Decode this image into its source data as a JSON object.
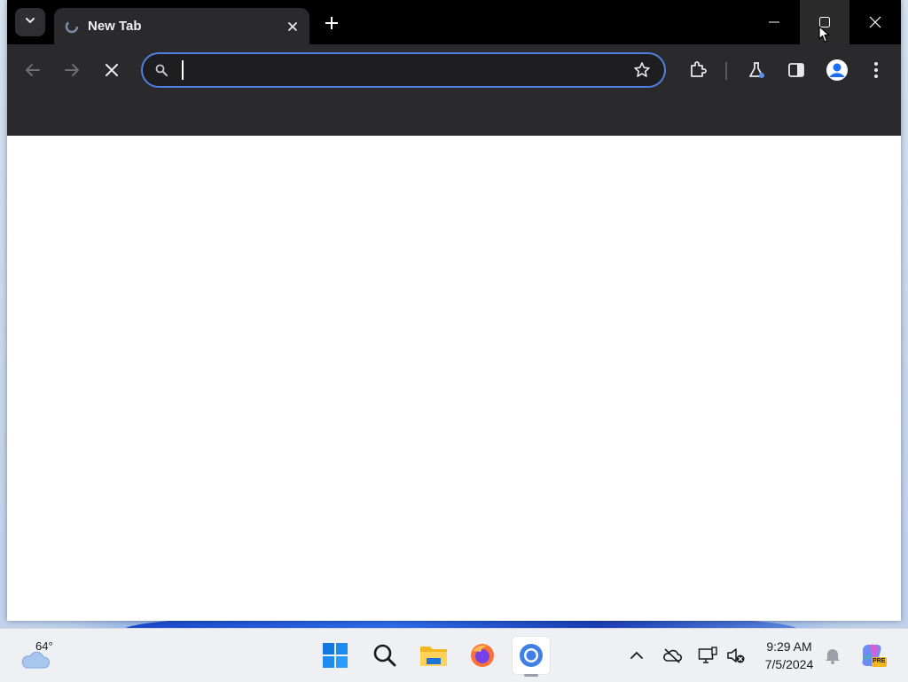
{
  "browser": {
    "tab": {
      "title": "New Tab"
    },
    "omnibox": {
      "value": "",
      "placeholder": ""
    }
  },
  "taskbar": {
    "weather": {
      "temp": "64°"
    },
    "clock": {
      "time": "9:29 AM",
      "date": "7/5/2024"
    },
    "copilot_badge": "PRE"
  },
  "colors": {
    "accent": "#4f7fe0",
    "titlebar": "#000000",
    "toolbar": "#2a2a2d",
    "taskbar": "#eef0f4"
  }
}
